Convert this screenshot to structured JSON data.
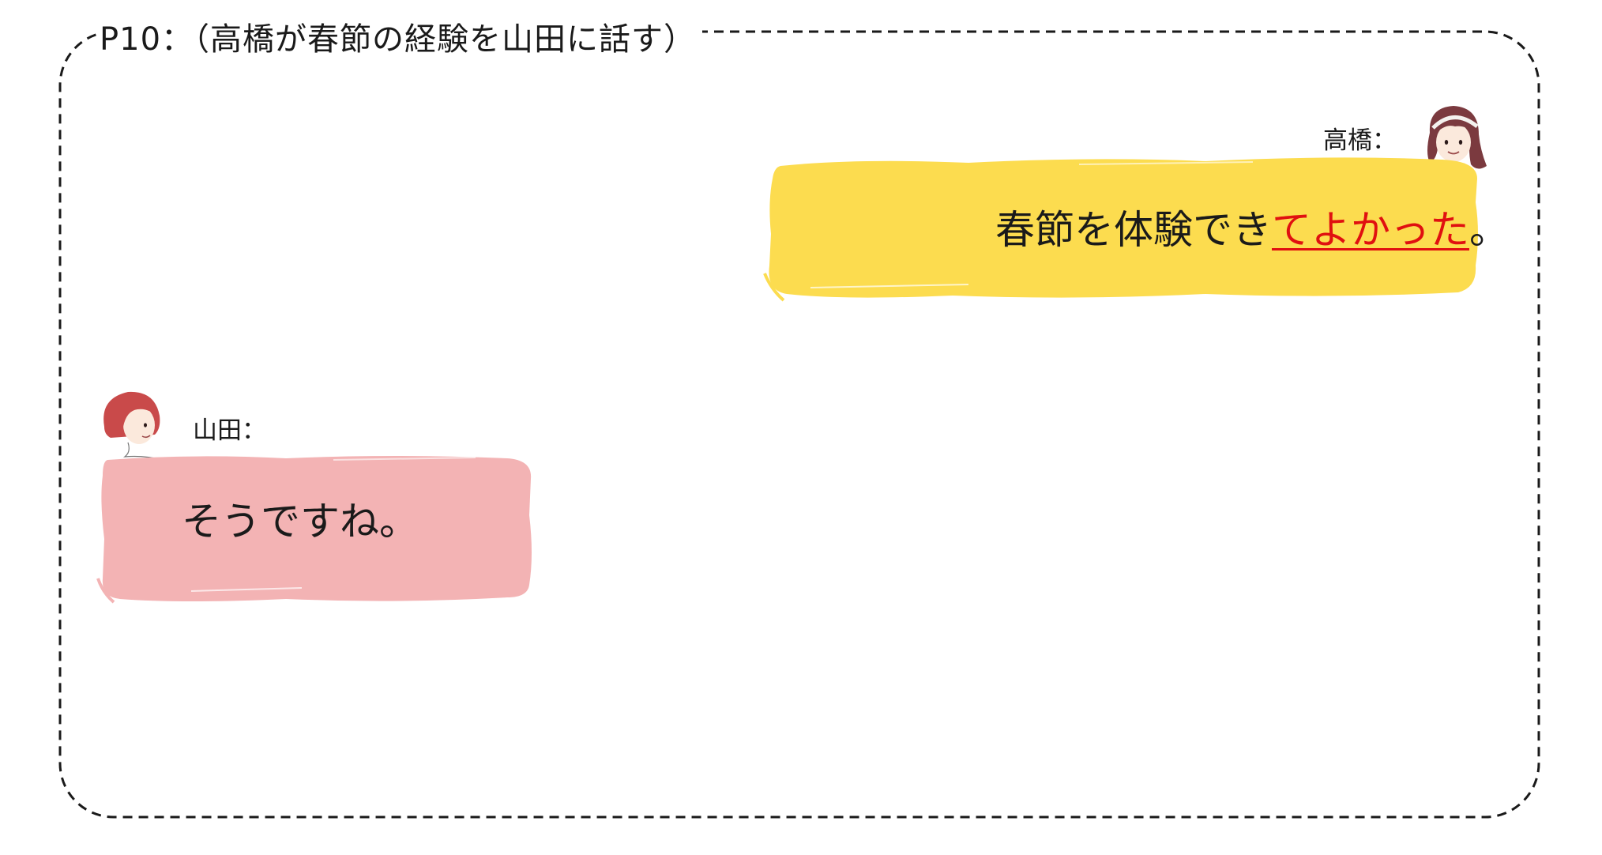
{
  "slide": {
    "title": "P10：（高橋が春節の経験を山田に話す）"
  },
  "dialogue": {
    "takahashi": {
      "name": "高橋：",
      "text_before": "春節を体験でき",
      "text_highlight": "てよかった",
      "text_after": "。"
    },
    "yamada": {
      "name": "山田：",
      "text": "そうですね。"
    }
  },
  "colors": {
    "takahashi_bubble": "#fcdc4f",
    "yamada_bubble": "#f3b3b4",
    "highlight": "#e01010",
    "frame": "#1a1a1a"
  }
}
